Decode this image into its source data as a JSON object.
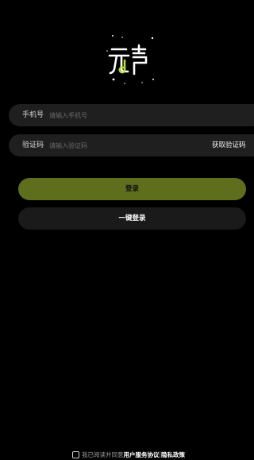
{
  "logo": {
    "text": "元声",
    "accent_color": "#b8e03a"
  },
  "form": {
    "phone": {
      "label": "手机号",
      "placeholder": "请输入手机号",
      "value": ""
    },
    "code": {
      "label": "验证码",
      "placeholder": "请输入验证码",
      "value": "",
      "get_code_label": "获取验证码"
    }
  },
  "buttons": {
    "login_label": "登录",
    "one_key_label": "一键登录"
  },
  "agreement": {
    "prefix": "我已阅读并同意",
    "user_agreement": "用户服务协议",
    "separator": "|",
    "privacy_policy": "隐私政策"
  },
  "colors": {
    "background": "#000000",
    "field_background": "#1f1f1f",
    "login_button": "#5f6e1c",
    "one_key_button": "#1a1a1a"
  }
}
